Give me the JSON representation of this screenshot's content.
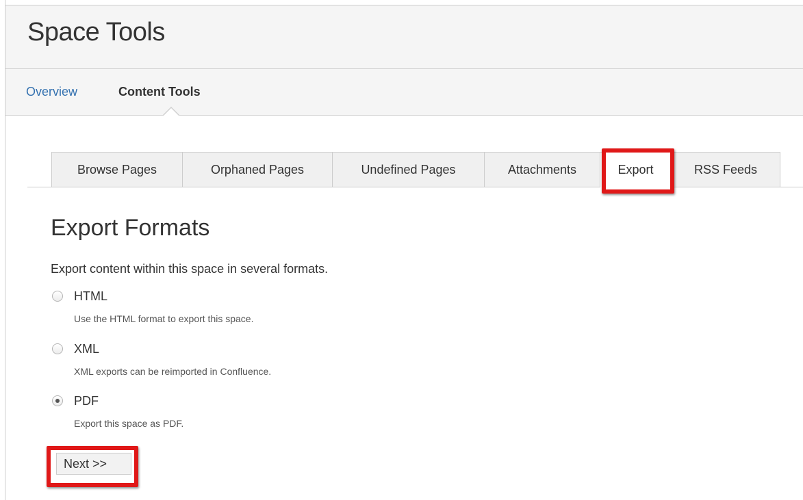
{
  "header": {
    "title": "Space Tools",
    "nav": [
      {
        "label": "Overview"
      },
      {
        "label": "Content Tools"
      }
    ]
  },
  "tabs": [
    {
      "label": "Browse Pages"
    },
    {
      "label": "Orphaned Pages"
    },
    {
      "label": "Undefined Pages"
    },
    {
      "label": "Attachments"
    },
    {
      "label": "Export"
    },
    {
      "label": "RSS Feeds"
    }
  ],
  "active_tab": "Export",
  "main": {
    "title": "Export Formats",
    "description": "Export content within this space in several formats.",
    "options": [
      {
        "label": "HTML",
        "description": "Use the HTML format to export this space.",
        "selected": false
      },
      {
        "label": "XML",
        "description": "XML exports can be reimported in Confluence.",
        "selected": false
      },
      {
        "label": "PDF",
        "description": "Export this space as PDF.",
        "selected": true
      }
    ],
    "next_label": "Next >>"
  },
  "colors": {
    "link": "#3572b0",
    "highlight": "#e01818",
    "header_bg": "#f5f5f5"
  }
}
